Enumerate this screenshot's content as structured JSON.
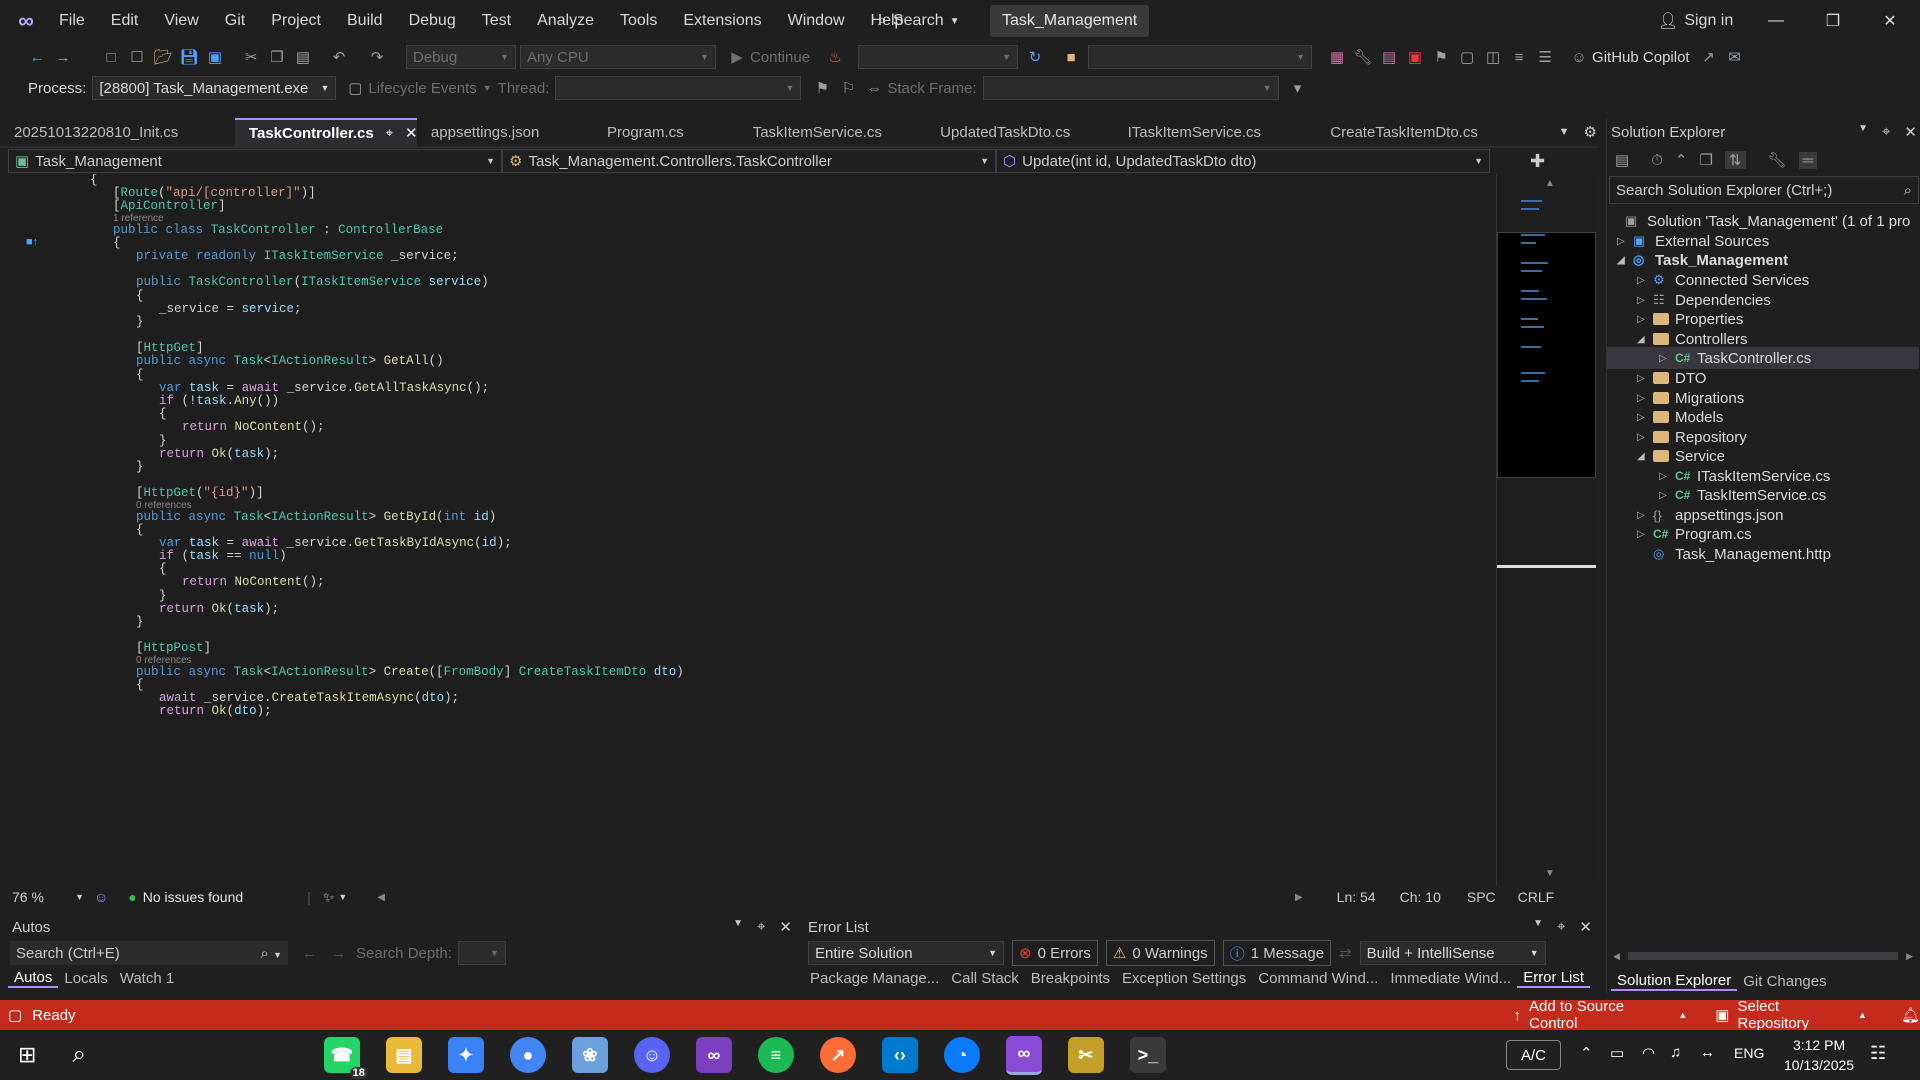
{
  "menu": {
    "items": [
      "File",
      "Edit",
      "View",
      "Git",
      "Project",
      "Build",
      "Debug",
      "Test",
      "Analyze",
      "Tools",
      "Extensions",
      "Window",
      "Help"
    ],
    "search_label": "Search",
    "solution_title": "Task_Management",
    "sign_in": "Sign in"
  },
  "toolbar": {
    "config": "Debug",
    "platform": "Any CPU",
    "continue_label": "Continue",
    "copilot_label": "GitHub Copilot",
    "process_label": "Process:",
    "process_value": "[28800] Task_Management.exe",
    "lifecycle_label": "Lifecycle Events",
    "thread_label": "Thread:",
    "stackframe_label": "Stack Frame:"
  },
  "tabs": [
    {
      "label": "20251013220810_Init.cs",
      "active": false
    },
    {
      "label": "TaskController.cs",
      "active": true
    },
    {
      "label": "appsettings.json",
      "active": false
    },
    {
      "label": "Program.cs",
      "active": false
    },
    {
      "label": "TaskItemService.cs",
      "active": false
    },
    {
      "label": "UpdatedTaskDto.cs",
      "active": false
    },
    {
      "label": "ITaskItemService.cs",
      "active": false
    },
    {
      "label": "CreateTaskItemDto.cs",
      "active": false
    }
  ],
  "navbar": {
    "project": "Task_Management",
    "class": "Task_Management.Controllers.TaskController",
    "member": "Update(int id, UpdatedTaskDto dto)"
  },
  "editor_status": {
    "zoom": "76 %",
    "issues": "No issues found",
    "line": "Ln: 54",
    "col": "Ch: 10",
    "spc": "SPC",
    "crlf": "CRLF"
  },
  "solution_explorer": {
    "title": "Solution Explorer",
    "search_placeholder": "Search Solution Explorer (Ctrl+;)",
    "solution": "Solution 'Task_Management' (1 of 1 pro",
    "external_sources": "External Sources",
    "project": "Task_Management",
    "items": {
      "connected": "Connected Services",
      "dependencies": "Dependencies",
      "properties": "Properties",
      "controllers": "Controllers",
      "taskcontroller": "TaskController.cs",
      "dto": "DTO",
      "migrations": "Migrations",
      "models": "Models",
      "repository": "Repository",
      "service": "Service",
      "itaskitemservice": "ITaskItemService.cs",
      "taskitemservice": "TaskItemService.cs",
      "appsettings": "appsettings.json",
      "program": "Program.cs",
      "http": "Task_Management.http"
    },
    "tab_solution": "Solution Explorer",
    "tab_git": "Git Changes"
  },
  "autos": {
    "title": "Autos",
    "search_placeholder": "Search (Ctrl+E)",
    "search_depth": "Search Depth:",
    "tabs": [
      "Autos",
      "Locals",
      "Watch 1"
    ]
  },
  "error_list": {
    "title": "Error List",
    "scope": "Entire Solution",
    "errors": "0 Errors",
    "warnings": "0 Warnings",
    "messages": "1 Message",
    "build": "Build + IntelliSense",
    "tabs": [
      "Package Manage...",
      "Call Stack",
      "Breakpoints",
      "Exception Settings",
      "Command Wind...",
      "Immediate Wind...",
      "Error List"
    ]
  },
  "statusbar": {
    "ready": "Ready",
    "source_control": "Add to Source Control",
    "repository": "Select Repository"
  },
  "taskbar": {
    "whatsapp_badge": "18",
    "ac": "A/C",
    "lang": "ENG",
    "time": "3:12 PM",
    "date": "10/13/2025"
  },
  "code_lines": [
    {
      "t": "{",
      "c": "pl",
      "i": 0
    },
    {
      "t": "[Route(\"api/[controller]\")]",
      "c": "attr",
      "i": 1
    },
    {
      "t": "[ApiController]",
      "c": "attr2",
      "i": 1
    },
    {
      "t": "1 reference",
      "c": "ref",
      "i": 1
    },
    {
      "t": "public class TaskController : ControllerBase",
      "c": "cls",
      "i": 1
    },
    {
      "t": "{",
      "c": "pl",
      "i": 1
    },
    {
      "t": "private readonly ITaskItemService _service;",
      "c": "field",
      "i": 2
    },
    {
      "t": "",
      "c": "pl",
      "i": 0
    },
    {
      "t": "public TaskController(ITaskItemService service)",
      "c": "ctor",
      "i": 2
    },
    {
      "t": "{",
      "c": "pl",
      "i": 2
    },
    {
      "t": "_service = service;",
      "c": "assign",
      "i": 3
    },
    {
      "t": "}",
      "c": "pl",
      "i": 2
    },
    {
      "t": "",
      "c": "pl",
      "i": 0
    },
    {
      "t": "[HttpGet]",
      "c": "attr2",
      "i": 2
    },
    {
      "t": "public async Task<IActionResult> GetAll()",
      "c": "m1",
      "i": 2
    },
    {
      "t": "{",
      "c": "pl",
      "i": 2
    },
    {
      "t": "var task = await _service.GetAllTaskAsync();",
      "c": "l1",
      "i": 3
    },
    {
      "t": "if (!task.Any())",
      "c": "if1",
      "i": 3
    },
    {
      "t": "{",
      "c": "pl",
      "i": 3
    },
    {
      "t": "return NoContent();",
      "c": "ret",
      "i": 4
    },
    {
      "t": "}",
      "c": "pl",
      "i": 3
    },
    {
      "t": "return Ok(task);",
      "c": "ret2",
      "i": 3
    },
    {
      "t": "}",
      "c": "pl",
      "i": 2
    },
    {
      "t": "",
      "c": "pl",
      "i": 0
    },
    {
      "t": "[HttpGet(\"{id}\")]",
      "c": "attr3",
      "i": 2
    },
    {
      "t": "0 references",
      "c": "ref",
      "i": 2
    },
    {
      "t": "public async Task<IActionResult> GetById(int id)",
      "c": "m2",
      "i": 2
    },
    {
      "t": "{",
      "c": "pl",
      "i": 2
    },
    {
      "t": "var task = await _service.GetTaskByIdAsync(id);",
      "c": "l2",
      "i": 3
    },
    {
      "t": "if (task == null)",
      "c": "if2",
      "i": 3
    },
    {
      "t": "{",
      "c": "pl",
      "i": 3
    },
    {
      "t": "return NoContent();",
      "c": "ret",
      "i": 4
    },
    {
      "t": "}",
      "c": "pl",
      "i": 3
    },
    {
      "t": "return Ok(task);",
      "c": "ret2",
      "i": 3
    },
    {
      "t": "}",
      "c": "pl",
      "i": 2
    },
    {
      "t": "",
      "c": "pl",
      "i": 0
    },
    {
      "t": "[HttpPost]",
      "c": "attr2",
      "i": 2
    },
    {
      "t": "0 references",
      "c": "ref",
      "i": 2
    },
    {
      "t": "public async Task<IActionResult> Create([FromBody] CreateTaskItemDto dto)",
      "c": "m3",
      "i": 2
    },
    {
      "t": "{",
      "c": "pl",
      "i": 2
    },
    {
      "t": "await _service.CreateTaskItemAsync(dto);",
      "c": "l3",
      "i": 3
    },
    {
      "t": "return Ok(dto);",
      "c": "ret2",
      "i": 3
    }
  ]
}
